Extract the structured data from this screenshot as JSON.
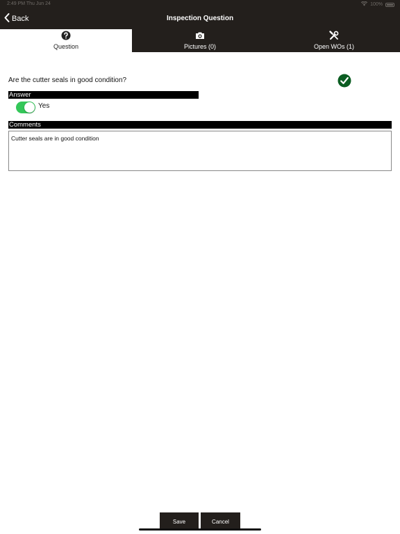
{
  "status_bar": {
    "time": "2:49 PM  Thu Jun 24",
    "battery": "100%"
  },
  "nav": {
    "back_label": "Back",
    "title": "Inspection Question"
  },
  "tabs": [
    {
      "label": "Question",
      "icon": "question-circle-icon",
      "active": true
    },
    {
      "label": "Pictures (0)",
      "icon": "camera-icon",
      "active": false
    },
    {
      "label": "Open WOs (1)",
      "icon": "tools-icon",
      "active": false
    }
  ],
  "question": {
    "text": "Are the cutter seals in good condition?",
    "status_icon": "check-circle-icon"
  },
  "answer": {
    "header": "Answer",
    "toggle_on": true,
    "toggle_label": "Yes"
  },
  "comments": {
    "header": "Comments",
    "value": "Cutter seals are in good condition"
  },
  "footer": {
    "save_label": "Save",
    "cancel_label": "Cancel"
  },
  "colors": {
    "bar": "#231f1c",
    "toggle_on": "#34c759",
    "check": "#0b5d22"
  }
}
